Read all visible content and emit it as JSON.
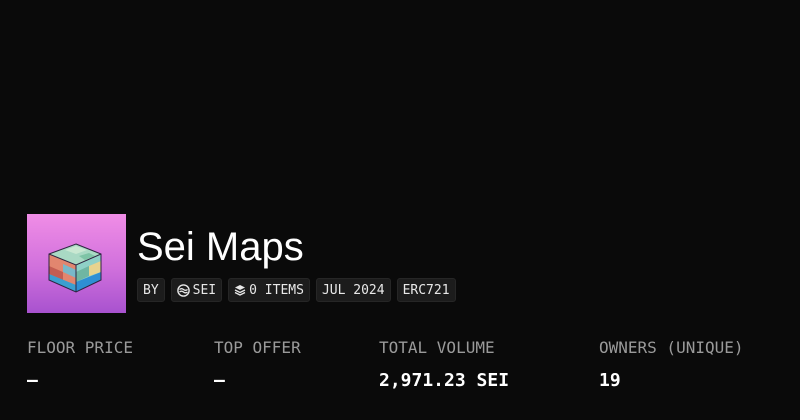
{
  "collection": {
    "name": "Sei Maps",
    "avatar_icon": "isometric-map-cube",
    "avatar_gradient": [
      "#f08de6",
      "#a852cf"
    ]
  },
  "chips": {
    "by_label": "BY",
    "creator": "SEI",
    "creator_icon": "sei-logo-icon",
    "items": "0 ITEMS",
    "items_icon": "layers-icon",
    "date": "JUL 2024",
    "standard": "ERC721"
  },
  "stats": [
    {
      "label": "FLOOR PRICE",
      "value": "—"
    },
    {
      "label": "TOP OFFER",
      "value": "—"
    },
    {
      "label": "TOTAL VOLUME",
      "value": "2,971.23 SEI"
    },
    {
      "label": "OWNERS (UNIQUE)",
      "value": "19"
    }
  ],
  "colors": {
    "background": "#0a0a0a",
    "chip_bg": "#1c1c1c",
    "label": "#9a9a9a",
    "text": "#ffffff"
  }
}
